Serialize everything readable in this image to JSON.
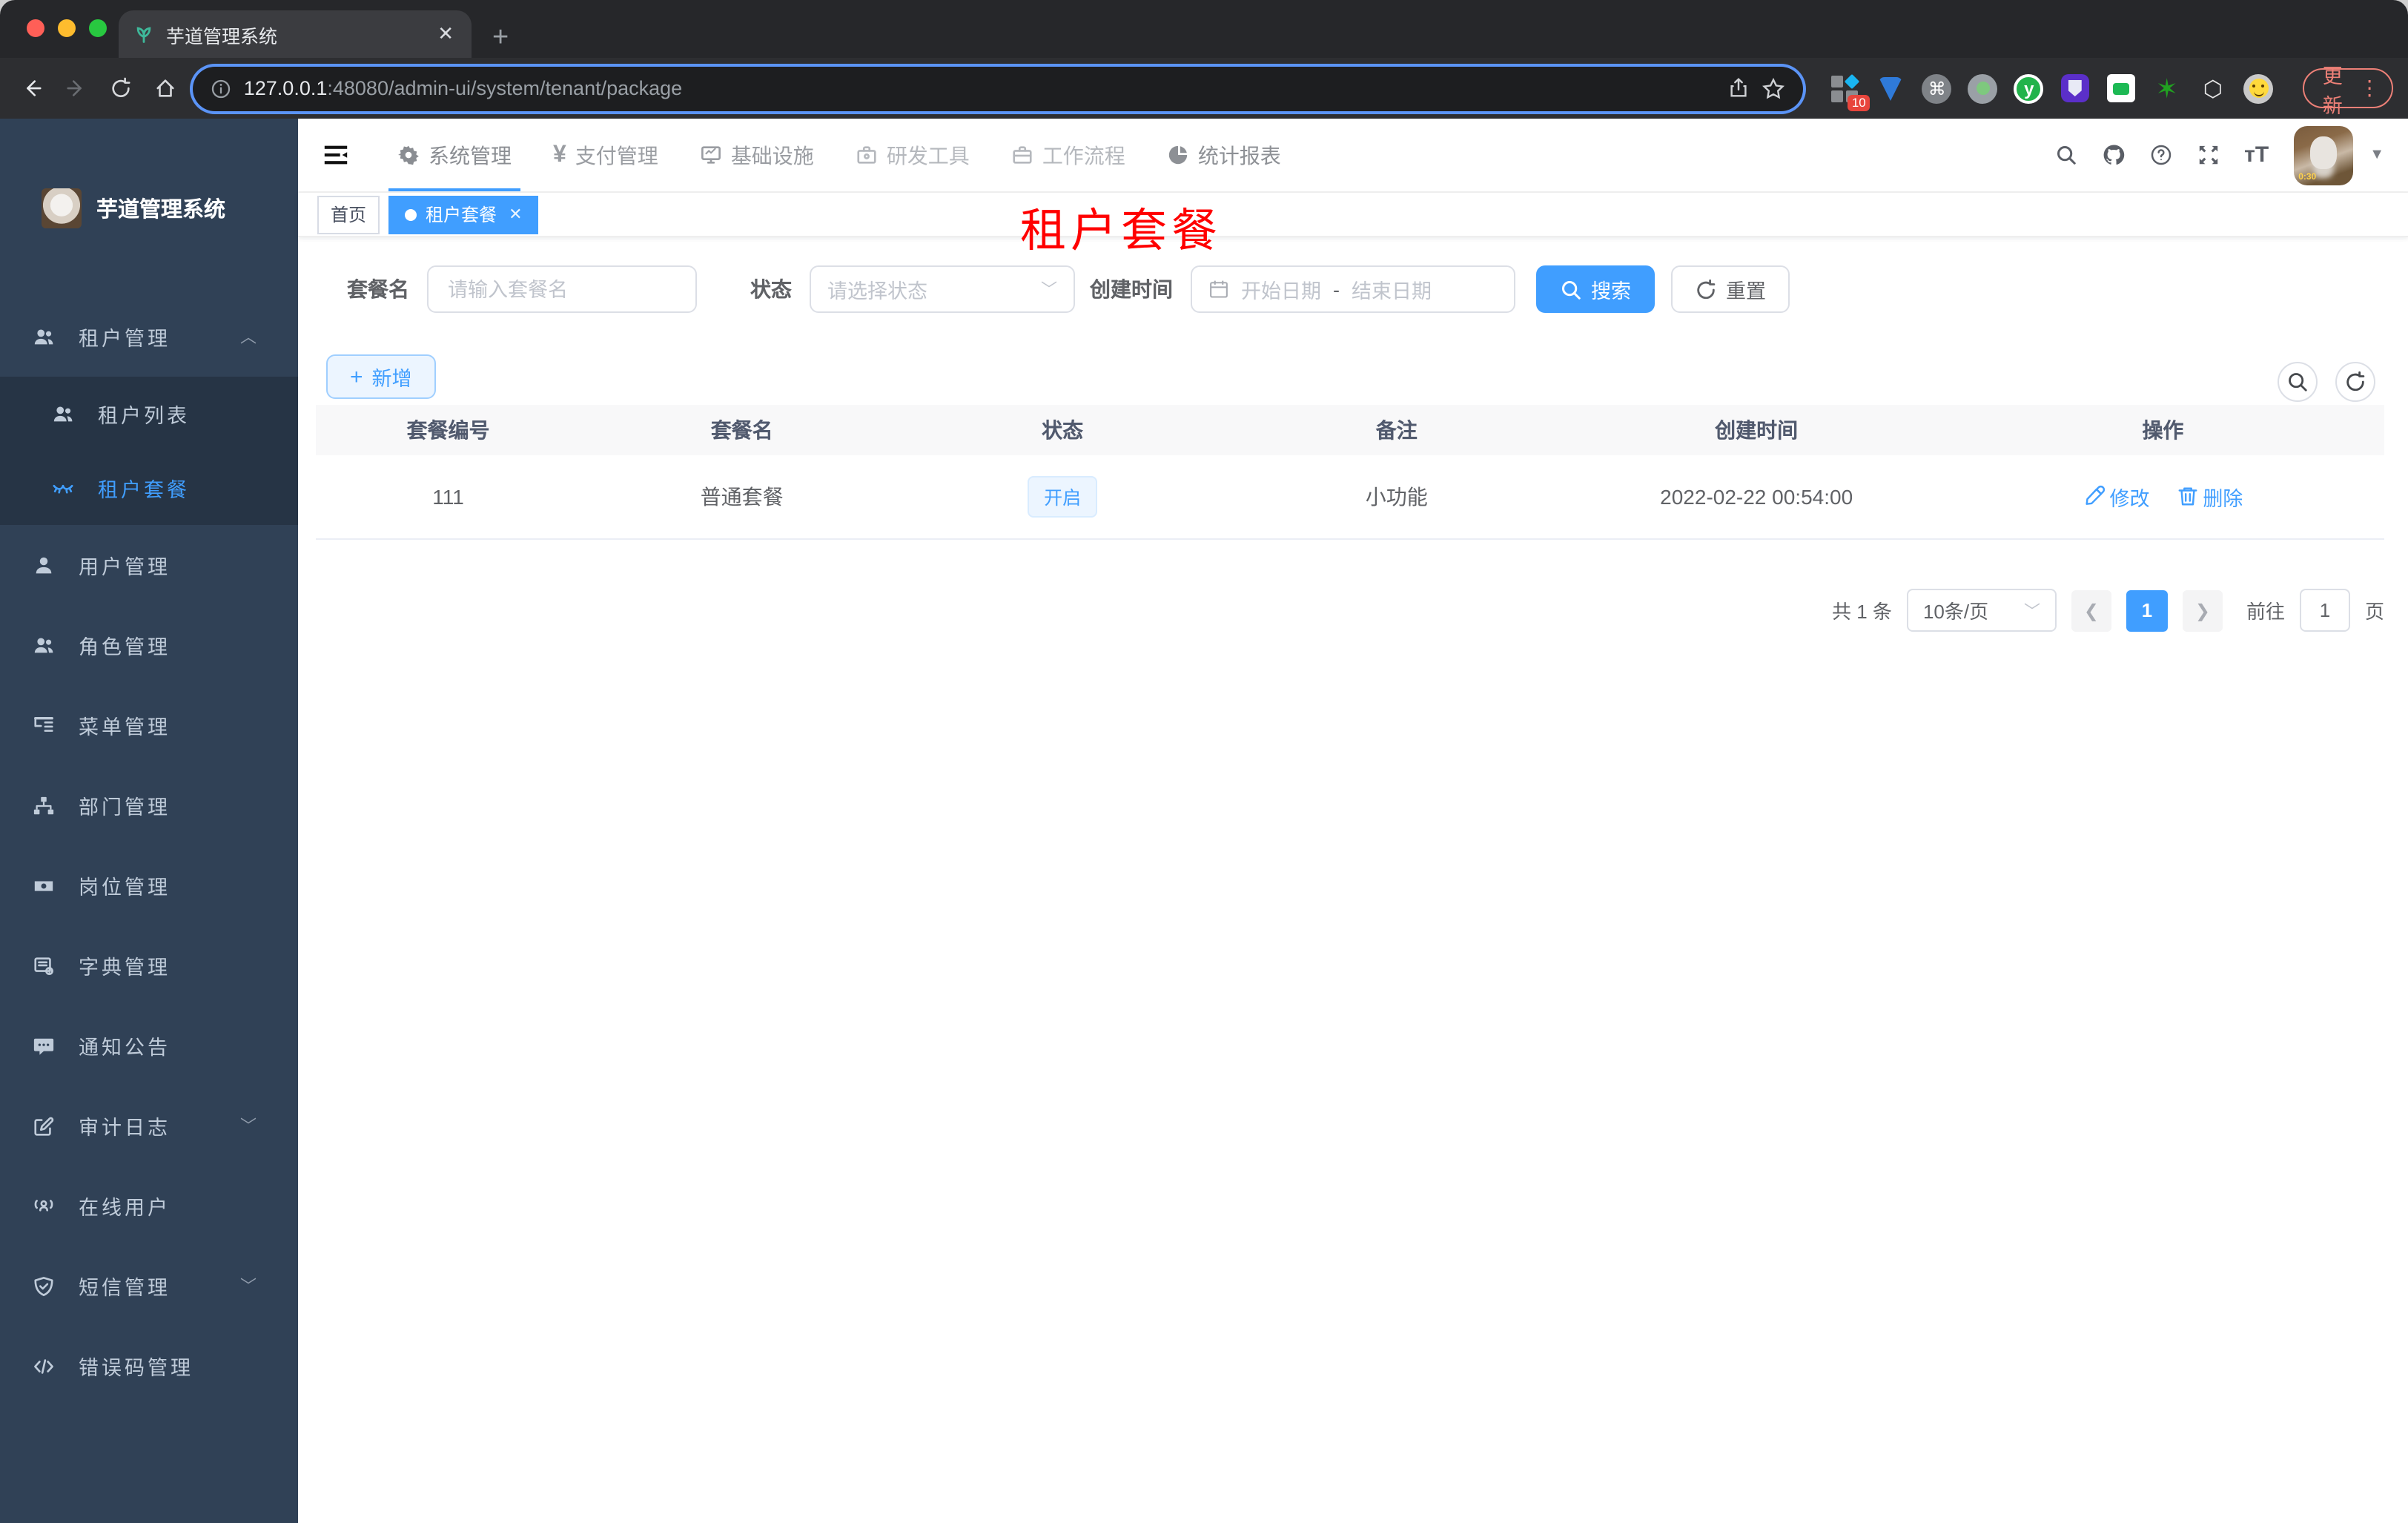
{
  "colors": {
    "accent": "#409eff",
    "red_title": "#ff0000",
    "sidebar_bg": "#304156",
    "submenu_bg": "#263445",
    "sidebar_text": "#bfcbd9",
    "tag_bg": "#ecf5ff",
    "tag_border": "#d9ecff",
    "table_header_bg": "#f8f8f9"
  },
  "browser": {
    "tab_title": "芋道管理系统",
    "url_host": "127.0.0.1",
    "url_rest": ":48080/admin-ui/system/tenant/package",
    "update_label": "更新",
    "extension_badge": "10",
    "icons": [
      "back",
      "forward",
      "reload",
      "home",
      "info",
      "share",
      "star",
      "extensions",
      "update",
      "more-menu"
    ]
  },
  "sidebar": {
    "logo_title": "芋道管理系统",
    "items": [
      {
        "label": "租户管理",
        "icon": "peoples",
        "expanded": true
      },
      {
        "label": "租户列表",
        "icon": "peoples",
        "sub": true
      },
      {
        "label": "租户套餐",
        "icon": "lashes",
        "sub": true,
        "active": true
      },
      {
        "label": "用户管理",
        "icon": "user"
      },
      {
        "label": "角色管理",
        "icon": "peoples"
      },
      {
        "label": "菜单管理",
        "icon": "tree-table"
      },
      {
        "label": "部门管理",
        "icon": "tree"
      },
      {
        "label": "岗位管理",
        "icon": "post"
      },
      {
        "label": "字典管理",
        "icon": "dict"
      },
      {
        "label": "通知公告",
        "icon": "message"
      },
      {
        "label": "审计日志",
        "icon": "log",
        "expandable": true
      },
      {
        "label": "在线用户",
        "icon": "online"
      },
      {
        "label": "短信管理",
        "icon": "sms",
        "expandable": true
      },
      {
        "label": "错误码管理",
        "icon": "code"
      }
    ]
  },
  "navbar": {
    "menus": [
      {
        "label": "系统管理",
        "icon": "gear",
        "active": true
      },
      {
        "label": "支付管理",
        "icon": "yen"
      },
      {
        "label": "基础设施",
        "icon": "monitor"
      },
      {
        "label": "研发工具",
        "icon": "toolbox"
      },
      {
        "label": "工作流程",
        "icon": "briefcase"
      },
      {
        "label": "统计报表",
        "icon": "dashboard"
      }
    ],
    "right_icons": [
      "search",
      "github",
      "question",
      "fullscreen",
      "font-size",
      "avatar",
      "caret-down"
    ],
    "avatar_overlay": "0:30"
  },
  "tags": {
    "home": "首页",
    "active": "租户套餐"
  },
  "page": {
    "red_title": "租户套餐"
  },
  "filters": {
    "name_label": "套餐名",
    "name_placeholder": "请输入套餐名",
    "status_label": "状态",
    "status_placeholder": "请选择状态",
    "created_label": "创建时间",
    "start_placeholder": "开始日期",
    "range_separator": "-",
    "end_placeholder": "结束日期",
    "search_label": "搜索",
    "reset_label": "重置"
  },
  "toolbar": {
    "add_label": "新增",
    "icon_buttons": [
      "search",
      "refresh"
    ]
  },
  "table": {
    "columns": [
      "套餐编号",
      "套餐名",
      "状态",
      "备注",
      "创建时间",
      "操作"
    ],
    "rows": [
      {
        "id": "111",
        "name": "普通套餐",
        "status": "开启",
        "remark": "小功能",
        "created": "2022-02-22 00:54:00",
        "edit_label": "修改",
        "delete_label": "删除"
      }
    ]
  },
  "pagination": {
    "total": "共 1 条",
    "page_size": "10条/页",
    "current": "1",
    "goto_label": "前往",
    "goto_value": "1",
    "unit": "页"
  }
}
